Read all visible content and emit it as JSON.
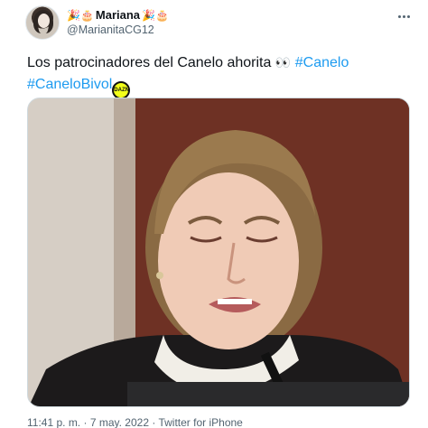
{
  "author": {
    "display_name": "Mariana",
    "emoji_prefix": "🎉🎂",
    "emoji_suffix": "🎉🎂",
    "handle": "@MarianitaCG12",
    "avatar_icon": "profile-photo"
  },
  "tweet": {
    "text_line1": "Los patrocinadores del Canelo ahorita",
    "eyes_emoji": "👀",
    "hashtag1": "#Canelo",
    "hashtag2": "#CaneloBivol",
    "badge_text": "DAZN"
  },
  "media": {
    "description_icon": "photo-crying-woman"
  },
  "meta": {
    "time": "11:41 p. m.",
    "separator": "·",
    "date": "7 may. 2022",
    "source": "Twitter for iPhone"
  },
  "colors": {
    "hashtag": "#1d9bf0",
    "secondary_text": "#536471",
    "primary_text": "#0f1419"
  }
}
